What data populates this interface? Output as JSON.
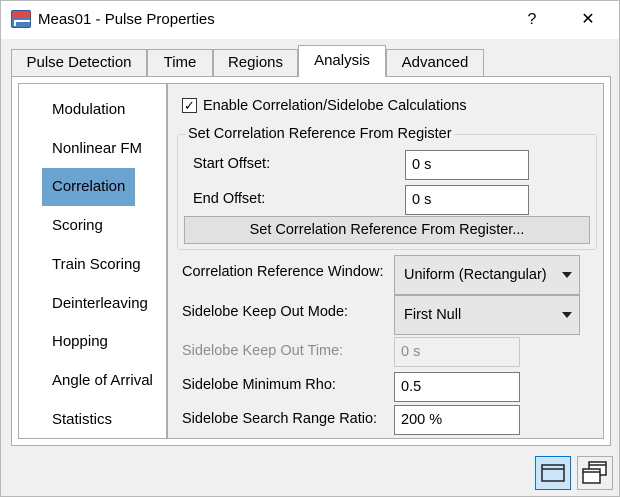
{
  "window": {
    "title": "Meas01 - Pulse Properties",
    "help_label": "?",
    "close_label": "✕"
  },
  "tabs": [
    {
      "label": "Pulse Detection"
    },
    {
      "label": "Time"
    },
    {
      "label": "Regions"
    },
    {
      "label": "Analysis",
      "active": true
    },
    {
      "label": "Advanced"
    }
  ],
  "nav": {
    "items": [
      {
        "label": "Modulation"
      },
      {
        "label": "Nonlinear FM"
      },
      {
        "label": "Correlation",
        "selected": true
      },
      {
        "label": "Scoring"
      },
      {
        "label": "Train Scoring"
      },
      {
        "label": "Deinterleaving"
      },
      {
        "label": "Hopping"
      },
      {
        "label": "Angle of Arrival"
      },
      {
        "label": "Statistics"
      }
    ]
  },
  "analysis": {
    "enable_label": "Enable Correlation/Sidelobe Calculations",
    "enable_checked": true,
    "check_mark": "✓",
    "group_title": "Set Correlation Reference From Register",
    "start_offset_label": "Start Offset:",
    "start_offset_value": "0 s",
    "end_offset_label": "End Offset:",
    "end_offset_value": "0 s",
    "set_ref_button": "Set Correlation Reference From Register...",
    "window_label": "Correlation Reference Window:",
    "window_value": "Uniform (Rectangular)",
    "keepout_mode_label": "Sidelobe Keep Out Mode:",
    "keepout_mode_value": "First Null",
    "keepout_time_label": "Sidelobe Keep Out Time:",
    "keepout_time_value": "0 s",
    "min_rho_label": "Sidelobe Minimum Rho:",
    "min_rho_value": "0.5",
    "search_ratio_label": "Sidelobe Search Range Ratio:",
    "search_ratio_value": "200 %"
  },
  "colors": {
    "selected_nav": "#6ba3d1",
    "active_toolbar": "#cce4f7"
  }
}
